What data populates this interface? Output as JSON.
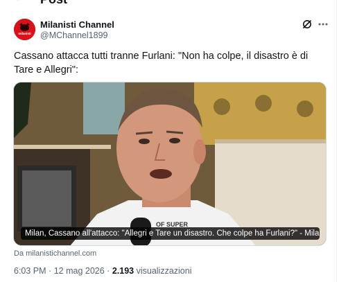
{
  "header": {
    "title": "Post",
    "back_icon": "back-arrow-icon"
  },
  "author": {
    "name": "Milanisti Channel",
    "handle": "@MChannel1899",
    "avatar_text": "milanisti",
    "avatar_color": "#d8111a"
  },
  "actions": {
    "grok_icon": "grok-icon",
    "more_icon": "more-icon"
  },
  "tweet": {
    "text": "Cassano attacca tutti tranne Furlani: \"Non ha colpe, il disastro è di Tare e Allegri\":"
  },
  "card": {
    "caption": "Milan, Cassano all'attacco: \"Allegri e Tare un disastro. Che colpe ha Furlani?\" - Milanisti...",
    "source": "Da milanistichannel.com"
  },
  "meta": {
    "time": "6:03 PM",
    "separator": "·",
    "date": "12 mag 2026",
    "views_count": "2.193",
    "views_label": "visualizzazioni"
  },
  "colors": {
    "text_primary": "#0f1419",
    "text_secondary": "#536471",
    "border": "#cfd9de"
  }
}
